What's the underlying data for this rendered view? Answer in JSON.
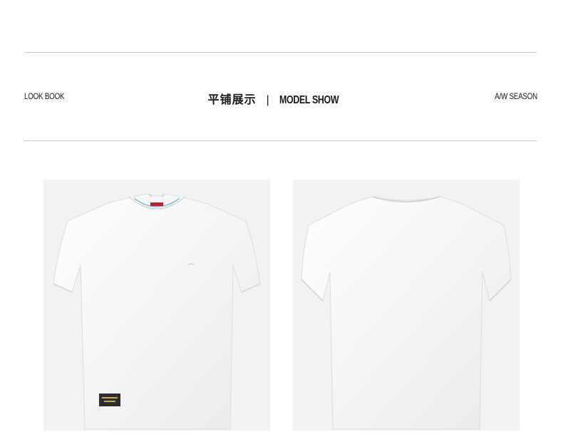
{
  "header": {
    "left_label": "LOOK BOOK",
    "title_cn": "平铺展示",
    "separator": "|",
    "title_en": "MODEL SHOW",
    "right_label": "A/W SEASON"
  },
  "photos": [
    {
      "view": "front",
      "icon": "tshirt-front-icon"
    },
    {
      "view": "back",
      "icon": "tshirt-back-icon"
    }
  ],
  "colors": {
    "shirt": "#ffffff",
    "photo_bg": "#f1f2f4",
    "rule": "#c8c8c8"
  }
}
